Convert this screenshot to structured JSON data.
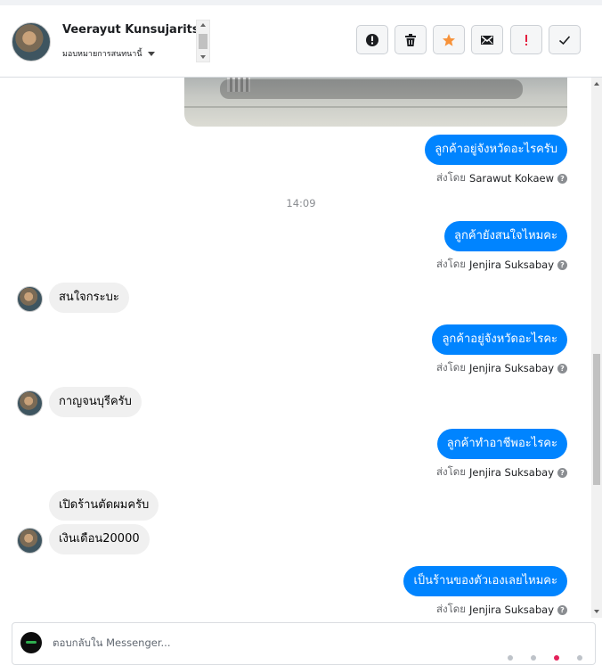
{
  "header": {
    "name": "Veerayut Kunsujaritsub",
    "assign_label": "มอบหมายการสนทนานี้"
  },
  "toolbar": {
    "buttons": [
      {
        "name": "report-spam-button",
        "icon": "alert-circle-icon"
      },
      {
        "name": "delete-button",
        "icon": "trash-icon"
      },
      {
        "name": "star-button",
        "icon": "star-icon",
        "color": "#f7923a"
      },
      {
        "name": "mark-unread-button",
        "icon": "envelope-icon"
      },
      {
        "name": "flag-important-button",
        "icon": "exclamation-icon",
        "color": "#e41e3f"
      },
      {
        "name": "mark-done-button",
        "icon": "checkmark-icon"
      }
    ]
  },
  "colors": {
    "outgoing_bubble": "#0084ff",
    "incoming_bubble": "#f0f0f0",
    "muted_text": "#65676b"
  },
  "messages": {
    "m1": {
      "text": "ลูกค้าอยู่จังหวัดอะไรครับ",
      "sent_prefix": "ส่งโดย",
      "sender": "Sarawut Kokaew"
    },
    "timestamp": "14:09",
    "m2": {
      "text": "ลูกค้ายังสนใจไหมคะ",
      "sent_prefix": "ส่งโดย",
      "sender": "Jenjira Suksabay"
    },
    "m3": {
      "text": "สนใจกระบะ"
    },
    "m4": {
      "text": "ลูกค้าอยู่จังหวัดอะไรคะ",
      "sent_prefix": "ส่งโดย",
      "sender": "Jenjira Suksabay"
    },
    "m5": {
      "text": "กาญจนบุรีครับ"
    },
    "m6": {
      "text": "ลูกค้าทำอาชีพอะไรคะ",
      "sent_prefix": "ส่งโดย",
      "sender": "Jenjira Suksabay"
    },
    "m7": {
      "text": "เปิดร้านตัดผมครับ"
    },
    "m8": {
      "text": "เงินเดือน20000"
    },
    "m9": {
      "text": "เป็นร้านของตัวเองเลยไหมคะ",
      "sent_prefix": "ส่งโดย",
      "sender": "Jenjira Suksabay"
    }
  },
  "composer": {
    "placeholder": "ตอบกลับใน Messenger..."
  }
}
